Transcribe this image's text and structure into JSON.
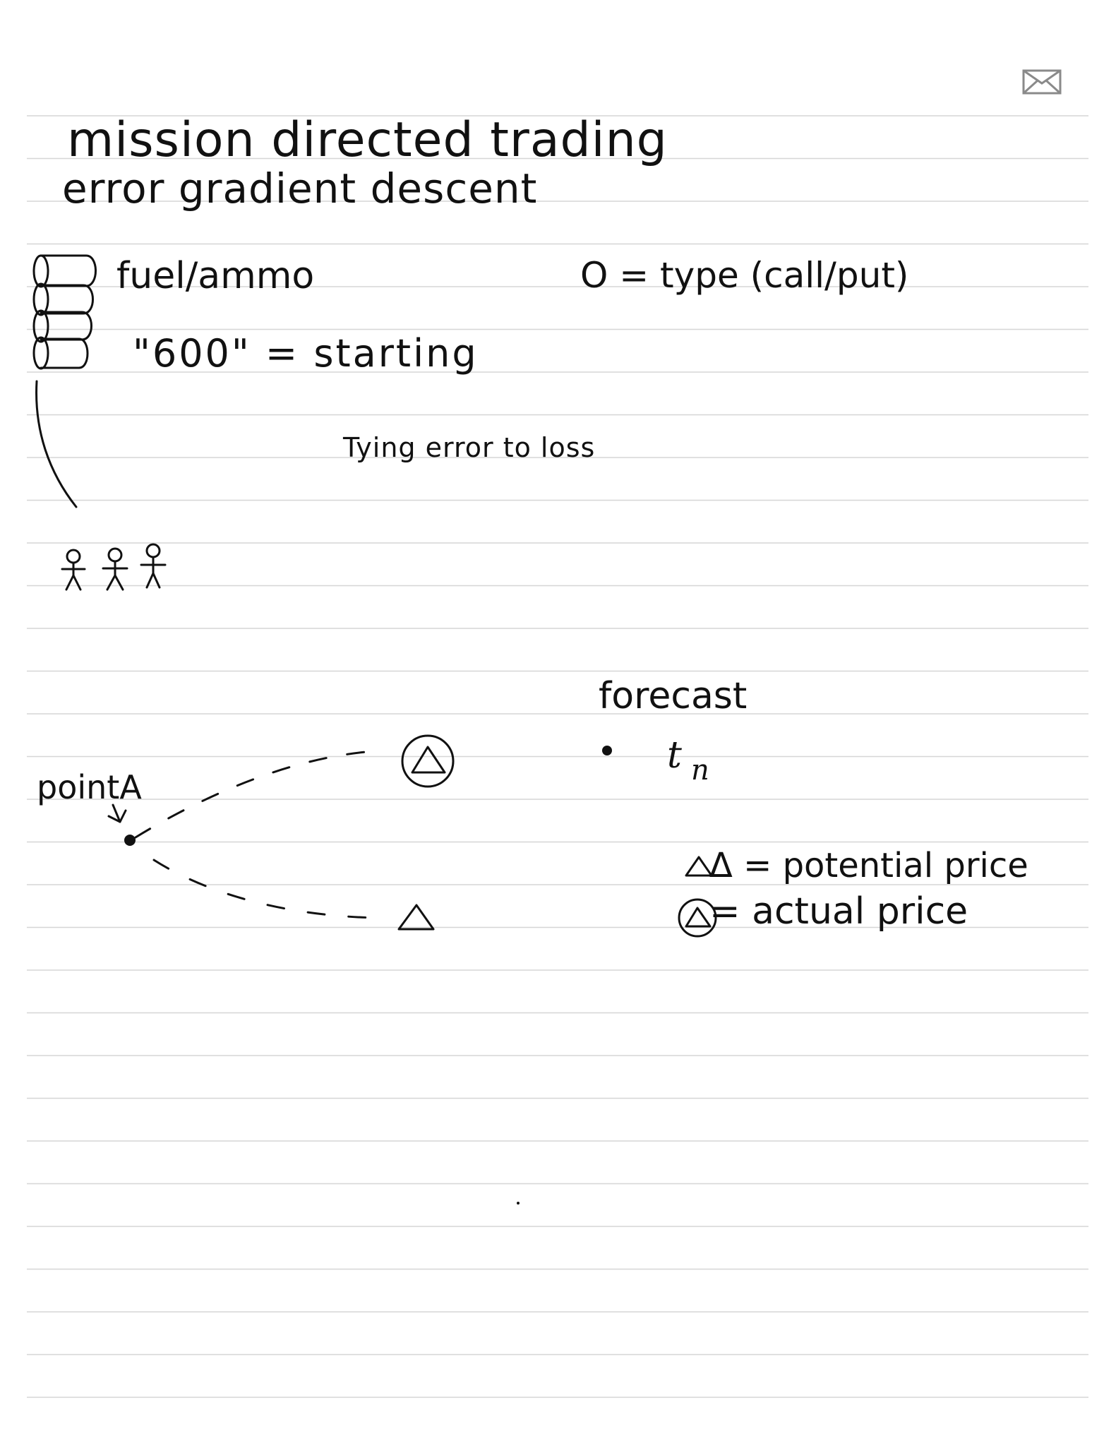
{
  "page": {
    "ink_color": "#111111",
    "rule_color": "#d6d6d6",
    "background": "#ffffff"
  },
  "header": {
    "mail_icon": "envelope-icon"
  },
  "title": {
    "line1": "mission directed trading",
    "line2": "error gradient descent"
  },
  "notes": {
    "fuel": "fuel/ammo",
    "option_type": "O = type (call/put)",
    "starting": "\"600\" = starting",
    "tying": "Tying error to loss"
  },
  "diagram": {
    "forecast": "forecast",
    "tn_t": "t",
    "tn_n": "n",
    "point_a": "pointA",
    "legend_potential": "Δ = potential price",
    "legend_actual": "= actual price"
  }
}
